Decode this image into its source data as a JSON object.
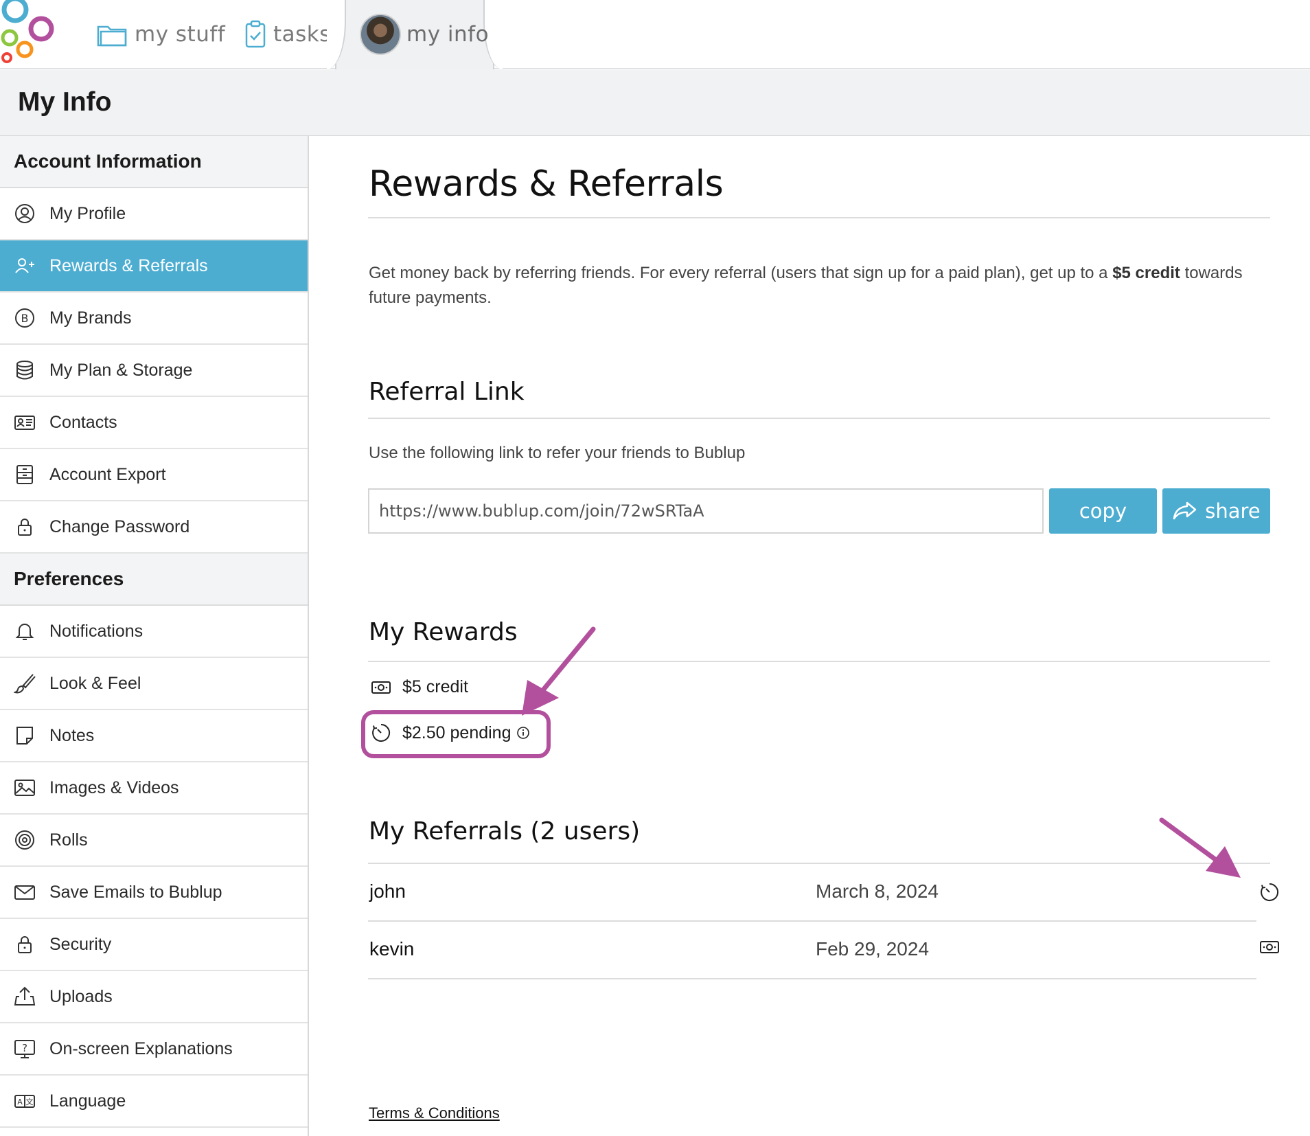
{
  "nav": {
    "tabs": [
      {
        "label": "my stuff",
        "icon": "folder-icon"
      },
      {
        "label": "tasks",
        "icon": "clipboard-check-icon"
      },
      {
        "label": "my info",
        "icon": "avatar",
        "active": true
      }
    ]
  },
  "page": {
    "title": "My Info"
  },
  "sidebar": {
    "sections": [
      {
        "title": "Account Information",
        "items": [
          {
            "label": "My Profile",
            "icon": "user-circle-icon"
          },
          {
            "label": "Rewards & Referrals",
            "icon": "user-plus-icon",
            "active": true
          },
          {
            "label": "My Brands",
            "icon": "brand-b-icon"
          },
          {
            "label": "My Plan & Storage",
            "icon": "database-icon"
          },
          {
            "label": "Contacts",
            "icon": "contact-card-icon"
          },
          {
            "label": "Account Export",
            "icon": "archive-icon"
          },
          {
            "label": "Change Password",
            "icon": "lock-icon"
          }
        ]
      },
      {
        "title": "Preferences",
        "items": [
          {
            "label": "Notifications",
            "icon": "bell-icon"
          },
          {
            "label": "Look & Feel",
            "icon": "brush-icon"
          },
          {
            "label": "Notes",
            "icon": "note-icon"
          },
          {
            "label": "Images & Videos",
            "icon": "image-icon"
          },
          {
            "label": "Rolls",
            "icon": "spiral-icon"
          },
          {
            "label": "Save Emails to Bublup",
            "icon": "envelope-icon"
          },
          {
            "label": "Security",
            "icon": "lock-icon"
          },
          {
            "label": "Uploads",
            "icon": "upload-icon"
          },
          {
            "label": "On-screen Explanations",
            "icon": "help-screen-icon"
          },
          {
            "label": "Language",
            "icon": "language-icon"
          }
        ]
      }
    ]
  },
  "main": {
    "title": "Rewards & Referrals",
    "intro_before": "Get money back by referring friends. For every referral (users that sign up for a paid plan), get up to a ",
    "intro_bold": "$5 credit",
    "intro_after": " towards future payments.",
    "referral_link": {
      "heading": "Referral Link",
      "subtitle": "Use the following link to refer your friends to Bublup",
      "url": "https://www.bublup.com/join/72wSRTaA",
      "copy_label": "copy",
      "share_label": "share"
    },
    "rewards": {
      "heading": "My Rewards",
      "credit": "$5 credit",
      "pending": "$2.50 pending"
    },
    "referrals": {
      "heading": "My Referrals (2 users)",
      "rows": [
        {
          "name": "john",
          "date": "March 8, 2024",
          "status_icon": "pending-clock-icon"
        },
        {
          "name": "kevin",
          "date": "Feb 29, 2024",
          "status_icon": "money-icon"
        }
      ]
    },
    "terms_label": "Terms & Conditions"
  },
  "colors": {
    "accent": "#4cadd1",
    "annotation": "#b2509d",
    "header_bg": "#f1f2f4"
  }
}
